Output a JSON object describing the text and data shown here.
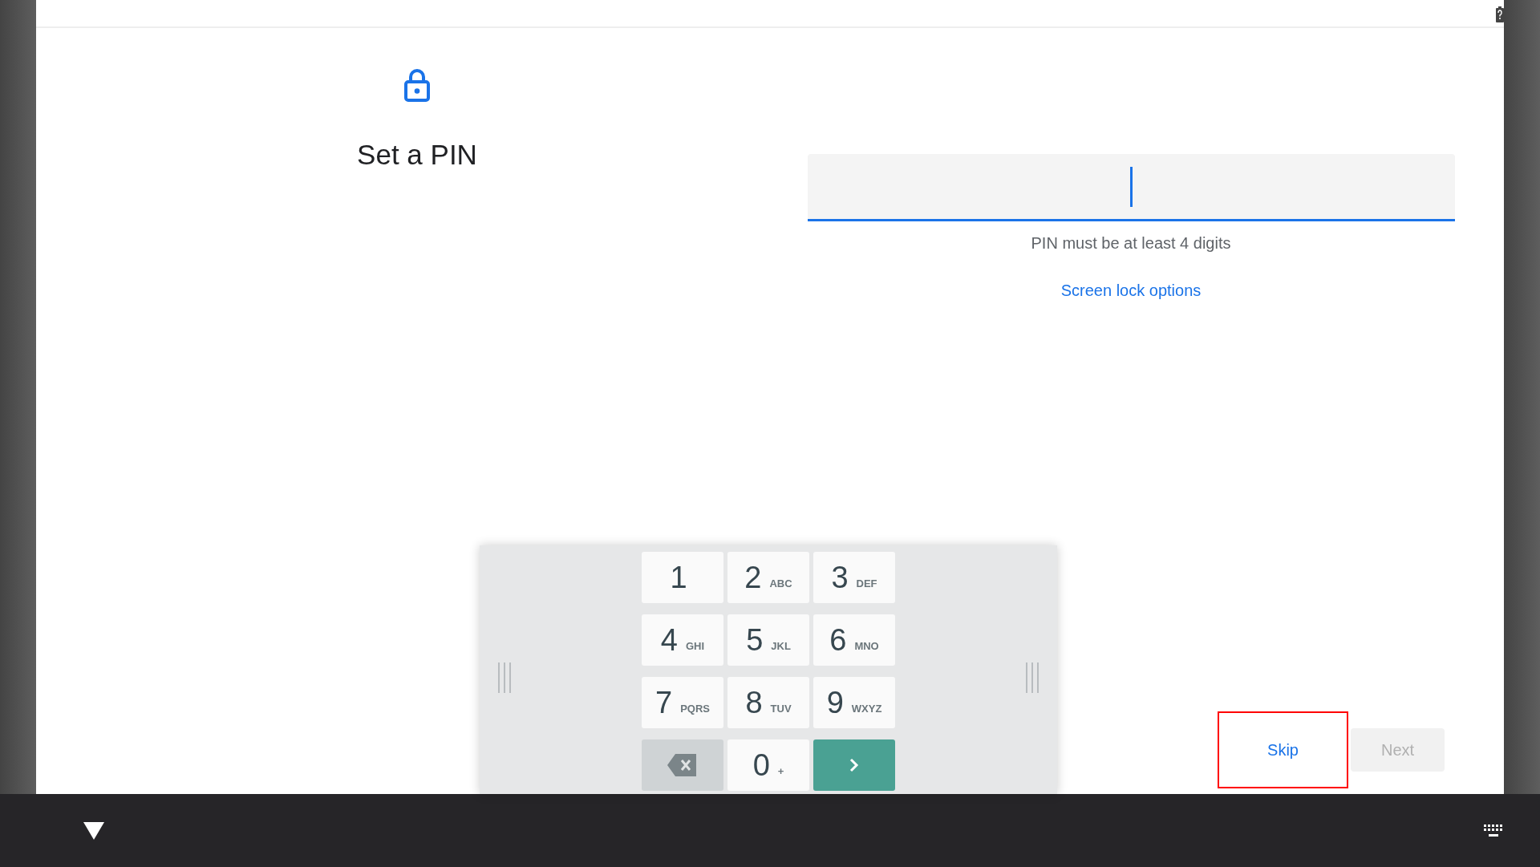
{
  "header": {
    "title": "Set a PIN"
  },
  "pin_field": {
    "focused": true
  },
  "hint": "PIN must be at least 4 digits",
  "link": "Screen lock options",
  "keypad": {
    "keys": [
      {
        "kind": "digit",
        "digit": "1"
      },
      {
        "kind": "digit",
        "digit": "2",
        "letters": "ABC"
      },
      {
        "kind": "digit",
        "digit": "3",
        "letters": "DEF"
      },
      {
        "kind": "digit",
        "digit": "4",
        "letters": "GHI"
      },
      {
        "kind": "digit",
        "digit": "5",
        "letters": "JKL"
      },
      {
        "kind": "digit",
        "digit": "6",
        "letters": "MNO"
      },
      {
        "kind": "digit",
        "digit": "7",
        "letters": "PQRS"
      },
      {
        "kind": "digit",
        "digit": "8",
        "letters": "TUV"
      },
      {
        "kind": "digit",
        "digit": "9",
        "letters": "WXYZ"
      },
      {
        "kind": "backspace"
      },
      {
        "kind": "digit",
        "digit": "0",
        "letters": "+"
      },
      {
        "kind": "enter"
      }
    ]
  },
  "buttons": [
    {
      "label": "Skip",
      "disabled": false,
      "highlighted": true
    },
    {
      "label": "Next",
      "disabled": true,
      "highlighted": false
    }
  ]
}
